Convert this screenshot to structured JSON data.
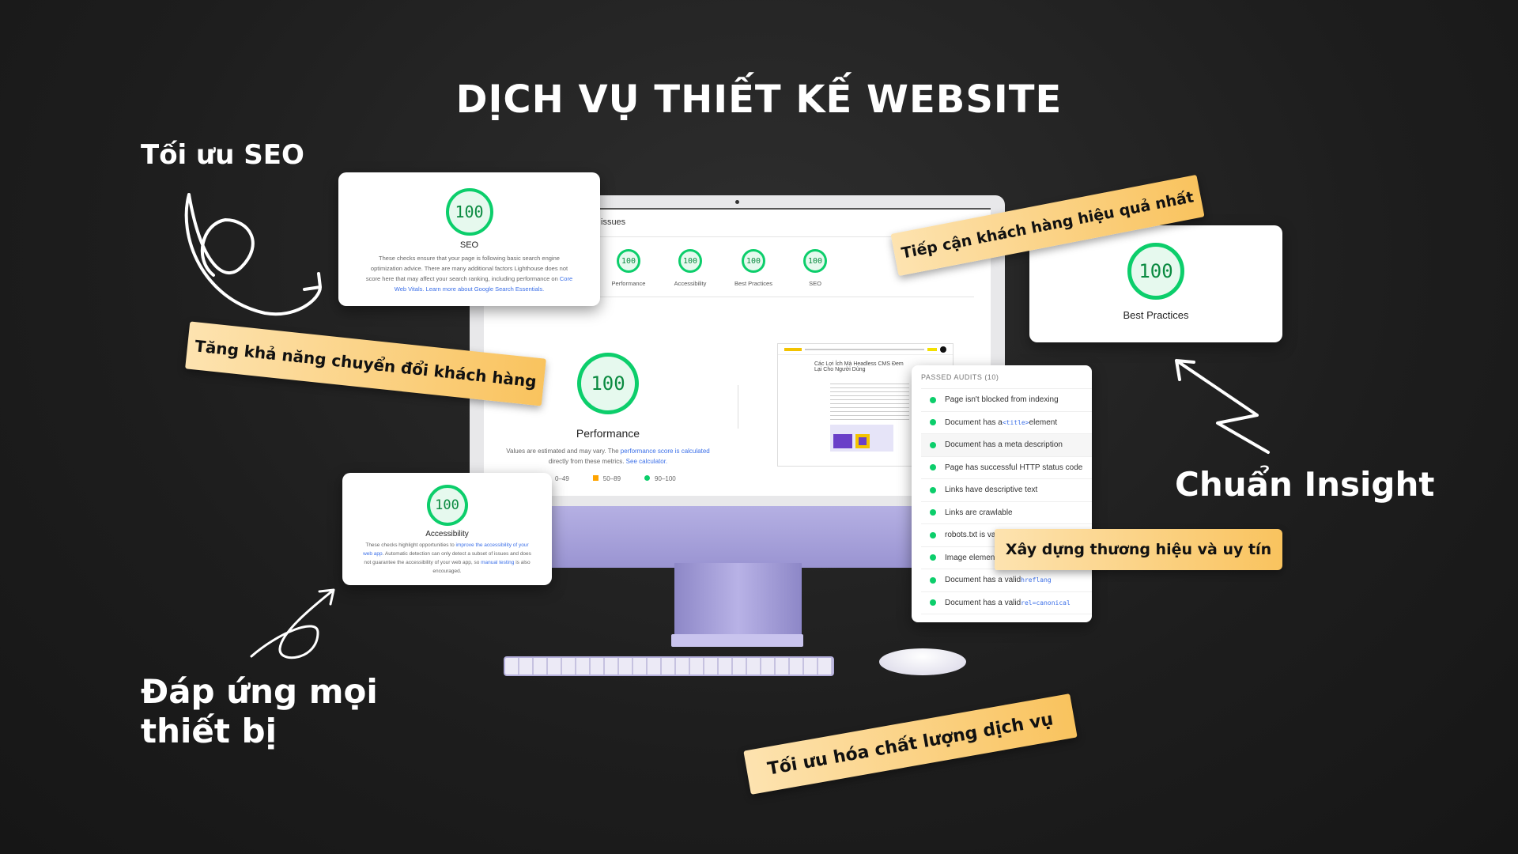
{
  "title": "DỊCH VỤ THIẾT KẾ WEBSITE",
  "headings": {
    "seo": "Tối ưu SEO",
    "insight": "Chuẩn Insight",
    "devices_line1": "Đáp ứng mọi",
    "devices_line2": "thiết bị"
  },
  "tags": {
    "conversion": "Tăng khả năng chuyển đổi khách hàng",
    "reach": "Tiếp cận khách hàng hiệu quả nhất",
    "brand": "Xây dựng thương hiệu và uy tín",
    "quality": "Tối ưu hóa chất lượng dịch vụ"
  },
  "colors": {
    "pass": "#0cce6b",
    "tag": "#f9c35e",
    "average": "#ffa400",
    "monitor": "#a9a3d8"
  },
  "seo_card": {
    "score": "100",
    "label": "SEO",
    "desc": "These checks ensure that your page is following basic search engine optimization advice. There are many additional factors Lighthouse does not score here that may affect your search ranking, including performance on",
    "link": "Core Web Vitals. Learn more about Google Search Essentials."
  },
  "bp_card": {
    "score": "100",
    "label": "Best Practices"
  },
  "a11y_card": {
    "score": "100",
    "label": "Accessibility",
    "desc1": "These checks highlight opportunities to",
    "link1": "improve the accessibility of your web app",
    "desc2": ". Automatic detection can only detect a subset of issues and does not guarantee the accessibility of your web app, so",
    "link2": "manual testing",
    "desc3": "is also encouraged."
  },
  "screen": {
    "issues": "issues",
    "scores": [
      {
        "score": "100",
        "label": "Performance"
      },
      {
        "score": "100",
        "label": "Accessibility"
      },
      {
        "score": "100",
        "label": "Best Practices"
      },
      {
        "score": "100",
        "label": "SEO"
      }
    ],
    "perf": {
      "score": "100",
      "label": "Performance",
      "text1": "Values are estimated and may vary. The",
      "link1": "performance score is calculated",
      "text2": "directly from these metrics.",
      "link2": "See calculator."
    },
    "legend": [
      "0–49",
      "50–89",
      "90–100"
    ],
    "thumb_title": "Các Lợi Ích Mà Headless CMS Đem Lại Cho Người Dùng"
  },
  "audits": {
    "header": "PASSED AUDITS (10)",
    "items": [
      {
        "text": "Page isn't blocked from indexing"
      },
      {
        "text": "Document has a ",
        "code": "<title>",
        "after": " element"
      },
      {
        "text": "Document has a meta description"
      },
      {
        "text": "Page has successful HTTP status code"
      },
      {
        "text": "Links have descriptive text"
      },
      {
        "text": "Links are crawlable"
      },
      {
        "text": "robots.txt is val"
      },
      {
        "text": "Image element"
      },
      {
        "text": "Document has a valid ",
        "code": "hreflang"
      },
      {
        "text": "Document has a valid ",
        "code": "rel=canonical"
      }
    ]
  }
}
